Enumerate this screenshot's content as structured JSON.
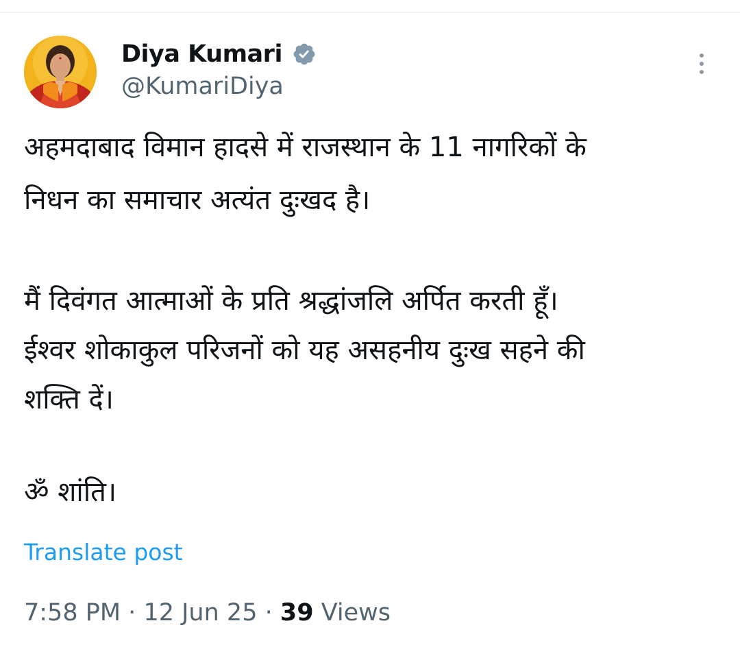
{
  "post": {
    "author": {
      "display_name": "Diya Kumari",
      "handle": "@KumariDiya",
      "verified": true,
      "avatar_icon": "profile-avatar"
    },
    "more_icon": "more-vertical-icon",
    "lines": {
      "p1_l1": "अहमदाबाद विमान हादसे में राजस्थान के 11 नागरिकों के",
      "p1_l2": "निधन का समाचार अत्यंत दुःखद है।",
      "p2_l1": "मैं दिवंगत आत्माओं के प्रति श्रद्धांजलि अर्पित करती हूँ।",
      "p2_l2": "ईश्वर शोकाकुल परिजनों को यह असहनीय दुःख सहने की",
      "p2_l3": "शक्ति दें।",
      "p3_l1": "ॐ शांति।"
    },
    "translate_label": "Translate post",
    "time": "7:58 PM",
    "date": "12 Jun 25",
    "separator": "·",
    "views_count": "39",
    "views_label": "Views"
  },
  "colors": {
    "text": "#0f1419",
    "secondary": "#536471",
    "link": "#1d9bf0",
    "verified_badge": "#829aab"
  }
}
